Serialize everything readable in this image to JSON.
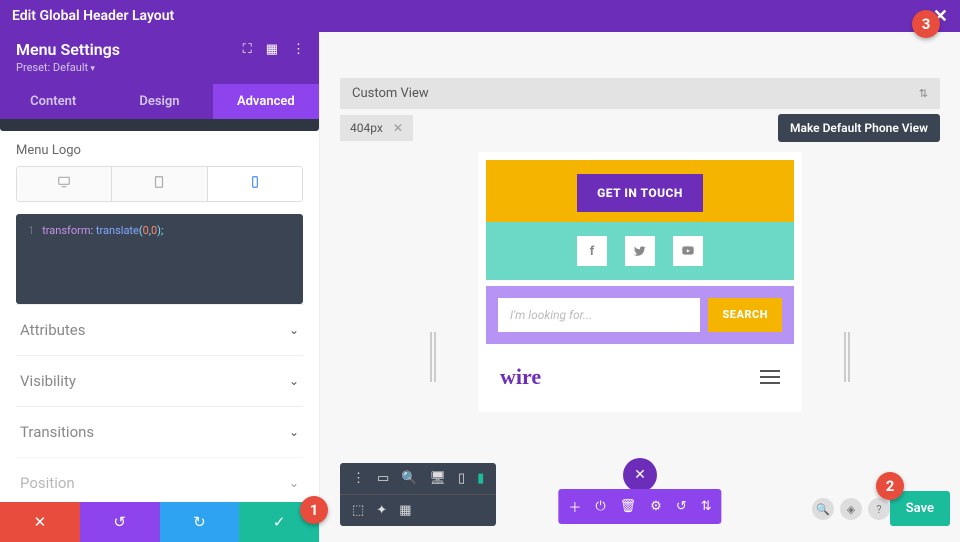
{
  "topbar": {
    "title": "Edit Global Header Layout"
  },
  "header": {
    "title": "Menu Settings",
    "preset": "Preset: Default"
  },
  "tabs": {
    "content": "Content",
    "design": "Design",
    "advanced": "Advanced"
  },
  "panel": {
    "logo_label": "Menu Logo",
    "code_line": "1",
    "code_kw": "transform",
    "code_fn": "translate",
    "code_a": "0",
    "code_b": "0"
  },
  "accordion": {
    "attributes": "Attributes",
    "visibility": "Visibility",
    "transitions": "Transitions",
    "position": "Position"
  },
  "canvas": {
    "custom_view": "Custom View",
    "size": "404px",
    "make_default": "Make Default Phone View",
    "cta": "GET IN TOUCH",
    "search_placeholder": "I'm looking for...",
    "search_btn": "SEARCH",
    "logo": "wire"
  },
  "save": "Save",
  "markers": {
    "m1": "1",
    "m2": "2",
    "m3": "3"
  }
}
